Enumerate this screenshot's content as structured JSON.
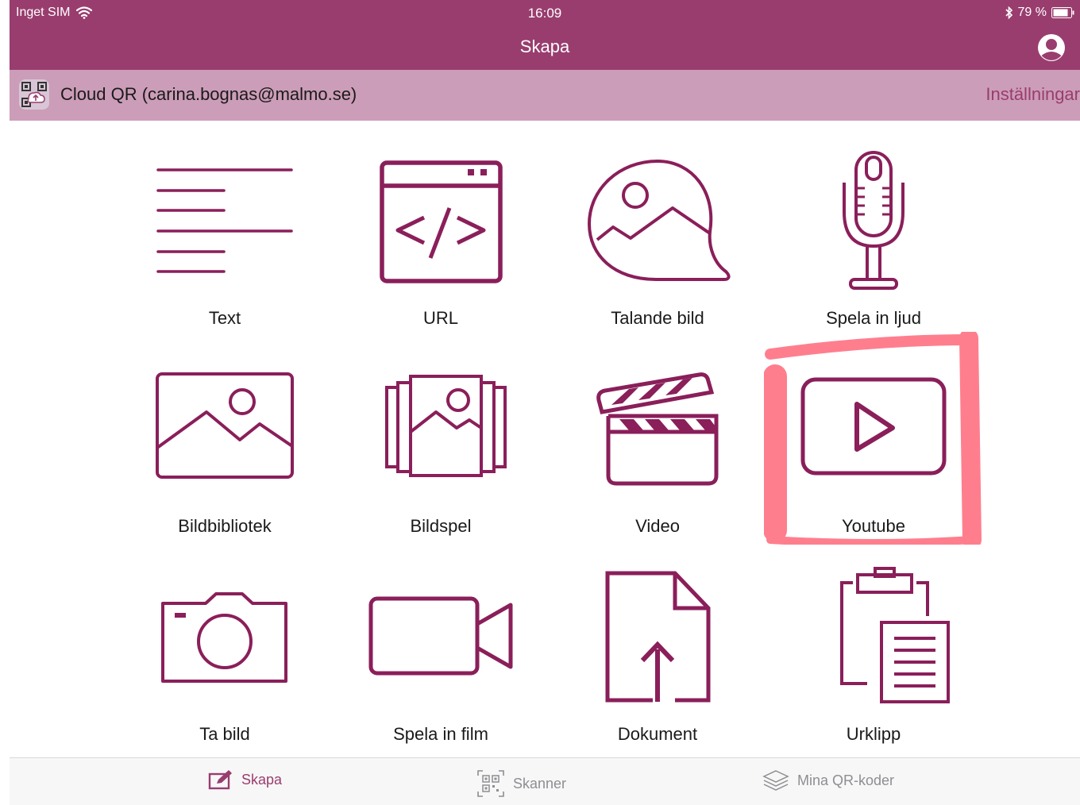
{
  "status_bar": {
    "carrier": "Inget SIM",
    "time": "16:09",
    "battery_text": "79 %"
  },
  "nav_bar": {
    "title": "Skapa",
    "profile_icon": "user-circle-icon"
  },
  "account_bar": {
    "account_text": "Cloud QR (carina.bognas@malmo.se)",
    "settings_label": "Inställningar"
  },
  "tiles": [
    {
      "label": "Text",
      "icon": "text-lines-icon"
    },
    {
      "label": "URL",
      "icon": "code-window-icon"
    },
    {
      "label": "Talande bild",
      "icon": "speech-image-icon"
    },
    {
      "label": "Spela in ljud",
      "icon": "microphone-icon"
    },
    {
      "label": "Bildbibliotek",
      "icon": "image-icon"
    },
    {
      "label": "Bildspel",
      "icon": "slideshow-icon"
    },
    {
      "label": "Video",
      "icon": "clapperboard-icon"
    },
    {
      "label": "Youtube",
      "icon": "youtube-play-icon"
    },
    {
      "label": "Ta bild",
      "icon": "camera-icon"
    },
    {
      "label": "Spela in film",
      "icon": "video-camera-icon"
    },
    {
      "label": "Dokument",
      "icon": "document-upload-icon"
    },
    {
      "label": "Urklipp",
      "icon": "clipboard-icon"
    }
  ],
  "tab_bar": {
    "tabs": [
      {
        "label": "Skapa",
        "icon": "pencil-edit-icon",
        "active": true
      },
      {
        "label": "Skanner",
        "icon": "qr-scan-icon",
        "active": false
      },
      {
        "label": "Mina QR-koder",
        "icon": "stack-layers-icon",
        "active": false
      }
    ]
  },
  "colors": {
    "brand": "#993d6f",
    "account_bar": "#cc9db8",
    "icon_stroke": "#8a1f5a",
    "highlight": "#ff5a6e"
  }
}
